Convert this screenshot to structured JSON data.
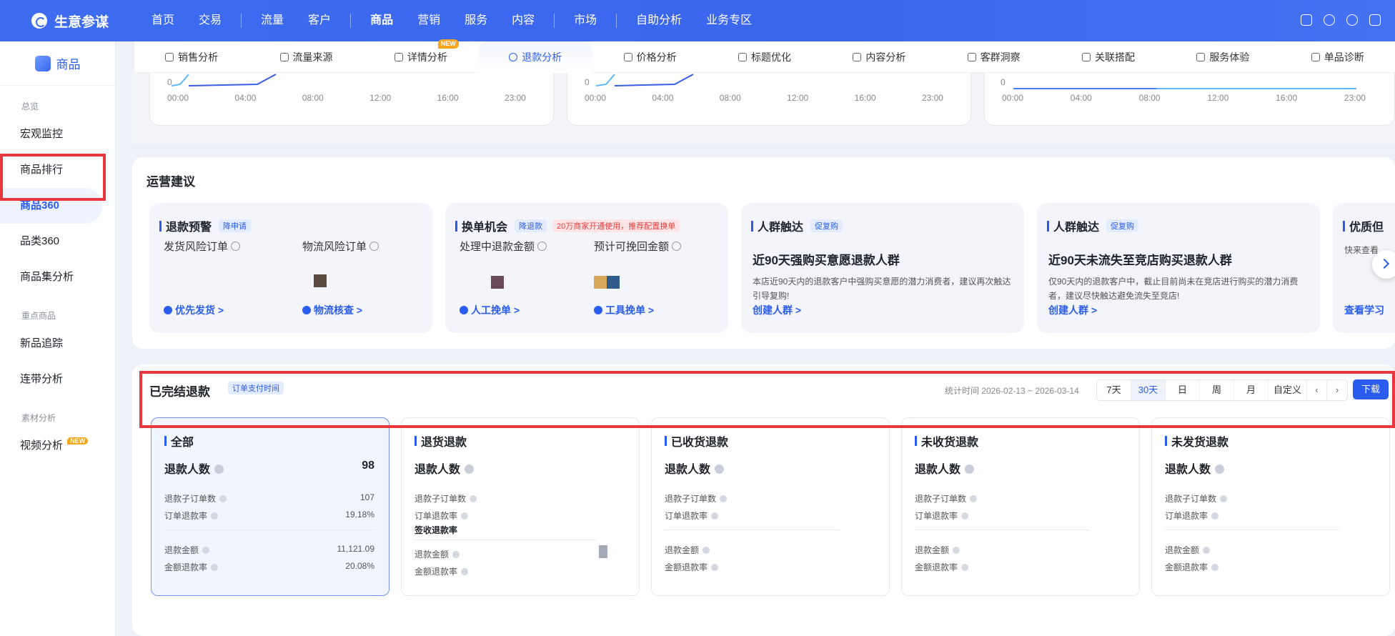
{
  "app": {
    "title": "生意参谋"
  },
  "topnav": [
    "首页",
    "交易",
    "流量",
    "客户",
    "商品",
    "营销",
    "服务",
    "内容",
    "市场",
    "自助分析",
    "业务专区"
  ],
  "topnav_active": "商品",
  "sidebar": {
    "header": "商品",
    "groups": [
      {
        "label": "总览",
        "items": [
          "宏观监控",
          "商品排行",
          "商品360",
          "品类360",
          "商品集分析"
        ]
      },
      {
        "label": "重点商品",
        "items": [
          "新品追踪",
          "连带分析"
        ]
      },
      {
        "label": "素材分析",
        "items": [
          "视频分析"
        ]
      }
    ],
    "active": "商品360",
    "new_badge": "NEW"
  },
  "subtabs": [
    "销售分析",
    "流量来源",
    "详情分析",
    "退款分析",
    "价格分析",
    "标题优化",
    "内容分析",
    "客群洞察",
    "关联搭配",
    "服务体验",
    "单品诊断"
  ],
  "subtab_active": "退款分析",
  "subtab_new": "NEW",
  "mini_charts": {
    "zero_label": "0",
    "ticks": [
      "00:00",
      "04:00",
      "08:00",
      "12:00",
      "16:00",
      "23:00"
    ]
  },
  "ops": {
    "title": "运营建议",
    "cards": [
      {
        "title": "退款预警",
        "tag": "降申请",
        "metric1": "发货风险订单",
        "metric2": "物流风险订单",
        "link1": "优先发货 >",
        "link2": "物流核查 >"
      },
      {
        "title": "换单机会",
        "tag": "降退款",
        "tag2": "20万商家开通使用，推荐配置换单",
        "metric1": "处理中退款金额",
        "metric2": "预计可挽回金额",
        "link1": "人工挽单 >",
        "link2": "工具挽单 >"
      },
      {
        "title": "人群触达",
        "tag": "促复购",
        "headline": "近90天强购买意愿退款人群",
        "desc": "本店近90天内的退款客户中强购买意愿的潜力消费者，建议再次触达引导复购!",
        "link": "创建人群 >"
      },
      {
        "title": "人群触达",
        "tag": "促复购",
        "headline": "近90天未流失至竞店购买退款人群",
        "desc": "仅90天内的退款客户中，截止目前尚未在竞店进行购买的潜力消费者，建议尽快触达避免流失至竞店!",
        "link": "创建人群 >"
      },
      {
        "title": "优质但",
        "desc": "快来查看",
        "link": "查看学习"
      }
    ]
  },
  "refund": {
    "title": "已完结退款",
    "tag": "订单支付时间",
    "stat_time": "统计时间 2026-02-13 ~ 2026-03-14",
    "periods": [
      "7天",
      "30天",
      "日",
      "周",
      "月",
      "自定义"
    ],
    "period_active": "30天",
    "download": "下载",
    "cards": [
      {
        "title": "全部",
        "main_label": "退款人数",
        "main_value": "98",
        "rows": [
          {
            "label": "退款子订单数",
            "value": "107"
          },
          {
            "label": "订单退款率",
            "value": "19.18%"
          },
          {
            "label": "退款金额",
            "value": "11,121.09"
          },
          {
            "label": "金额退款率",
            "value": "20.08%"
          }
        ]
      },
      {
        "title": "退货退款",
        "main_label": "退款人数",
        "rows": [
          {
            "label": "退款子订单数"
          },
          {
            "label": "订单退款率"
          },
          {
            "label": "签收退款率"
          },
          {
            "label": "退款金额"
          },
          {
            "label": "金额退款率"
          }
        ]
      },
      {
        "title": "已收货退款",
        "main_label": "退款人数",
        "rows": [
          {
            "label": "退款子订单数"
          },
          {
            "label": "订单退款率"
          },
          {
            "label": "退款金额"
          },
          {
            "label": "金额退款率"
          }
        ]
      },
      {
        "title": "未收货退款",
        "main_label": "退款人数",
        "rows": [
          {
            "label": "退款子订单数"
          },
          {
            "label": "订单退款率"
          },
          {
            "label": "退款金额"
          },
          {
            "label": "金额退款率"
          }
        ]
      },
      {
        "title": "未发货退款",
        "main_label": "退款人数",
        "rows": [
          {
            "label": "退款子订单数"
          },
          {
            "label": "订单退款率"
          },
          {
            "label": "退款金额"
          },
          {
            "label": "金额退款率"
          }
        ]
      }
    ]
  },
  "colors": {
    "accent": "#2a5cf0",
    "highlight": "#e8383d",
    "topbar": "#3d6cf0"
  }
}
